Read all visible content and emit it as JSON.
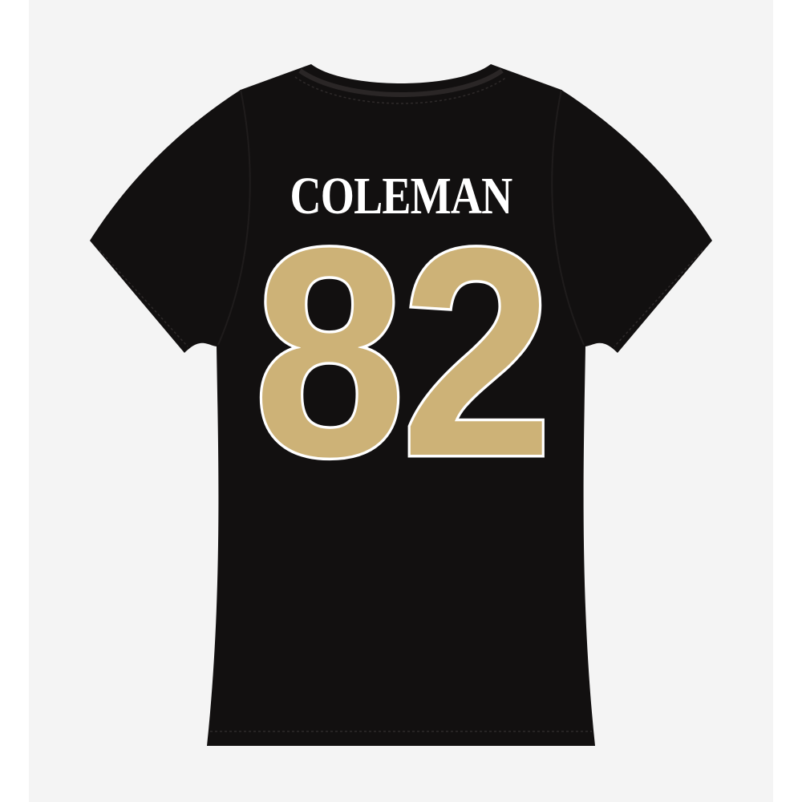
{
  "product": {
    "player_name": "COLEMAN",
    "player_number": "82",
    "garment_view": "back",
    "colors": {
      "shirt": "#121010",
      "number_fill": "#cdb277",
      "number_outline": "#ffffff",
      "name_text": "#ffffff",
      "backdrop": "#f4f4f4"
    }
  }
}
